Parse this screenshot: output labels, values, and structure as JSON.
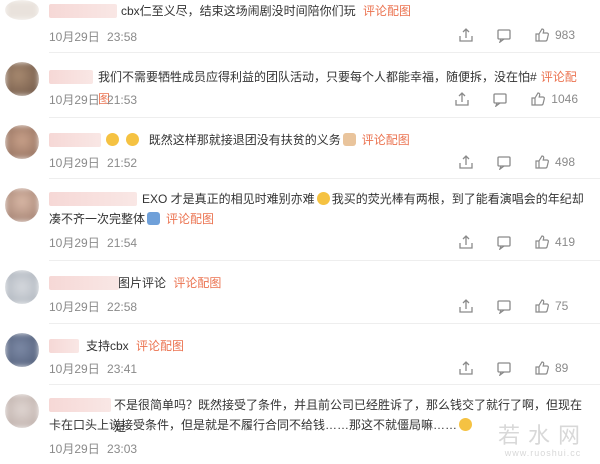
{
  "labels": {
    "comment_image": "评论配图"
  },
  "colors": {
    "link": "#eb7350",
    "meta": "#8a8a8a"
  },
  "comments": [
    {
      "text": "cbx仁至义尽，结束这场闹剧没时间陪你们玩",
      "date": "10月29日",
      "time": "23:58",
      "likes": "983"
    },
    {
      "text": "我们不需要牺牲成员应得利益的团队活动，只要每个人都能幸福，随便拆，没在怕#",
      "date": "10月29日",
      "time": "21:53",
      "likes": "1046"
    },
    {
      "text": "既然这样那就接退团没有扶贫的义务",
      "date": "10月29日",
      "time": "21:52",
      "likes": "498",
      "link": "评论配图"
    },
    {
      "text_line1": "EXO 才是真正的相见时难别亦难",
      "text_line1b": "我买的荧光棒有两根，到了能看演唱会的年纪却",
      "text_line2": "凑不齐一次完整体",
      "date": "10月29日",
      "time": "21:54",
      "likes": "419"
    },
    {
      "text": "图片评论",
      "date": "10月29日",
      "time": "22:58",
      "likes": "75"
    },
    {
      "text": "支持cbx",
      "date": "10月29日",
      "time": "23:41",
      "likes": "89"
    },
    {
      "text_line1": "不是很简单吗？既然接受了条件，并且前公司已经胜诉了，那么钱交了就行了啊，但现在是",
      "text_line2": "卡在口头上说接受条件，但是就是不履行合同不给钱……那这不就僵局嘛……",
      "date": "10月29日",
      "time": "23:03"
    }
  ],
  "watermark": {
    "main": "若水网",
    "sub": "www.ruoshui.cc"
  }
}
